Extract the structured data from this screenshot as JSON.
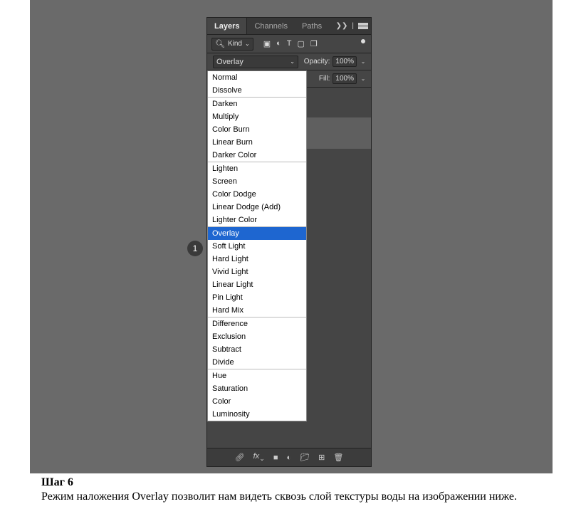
{
  "tabs": {
    "layers": "Layers",
    "channels": "Channels",
    "paths": "Paths"
  },
  "kind": {
    "label": "Kind"
  },
  "blend_current": "Overlay",
  "opacity": {
    "label": "Opacity:",
    "value": "100%"
  },
  "fill": {
    "label": "Fill:",
    "value": "100%"
  },
  "blend_modes": {
    "g0": [
      "Normal",
      "Dissolve"
    ],
    "g1": [
      "Darken",
      "Multiply",
      "Color Burn",
      "Linear Burn",
      "Darker Color"
    ],
    "g2": [
      "Lighten",
      "Screen",
      "Color Dodge",
      "Linear Dodge (Add)",
      "Lighter Color"
    ],
    "g3": [
      "Overlay",
      "Soft Light",
      "Hard Light",
      "Vivid Light",
      "Linear Light",
      "Pin Light",
      "Hard Mix"
    ],
    "g4": [
      "Difference",
      "Exclusion",
      "Subtract",
      "Divide"
    ],
    "g5": [
      "Hue",
      "Saturation",
      "Color",
      "Luminosity"
    ]
  },
  "callout": "1",
  "caption": {
    "title": "Шаг 6",
    "text": "Режим наложения Overlay позволит нам видеть сквозь слой текстуры воды на изображении ниже."
  }
}
